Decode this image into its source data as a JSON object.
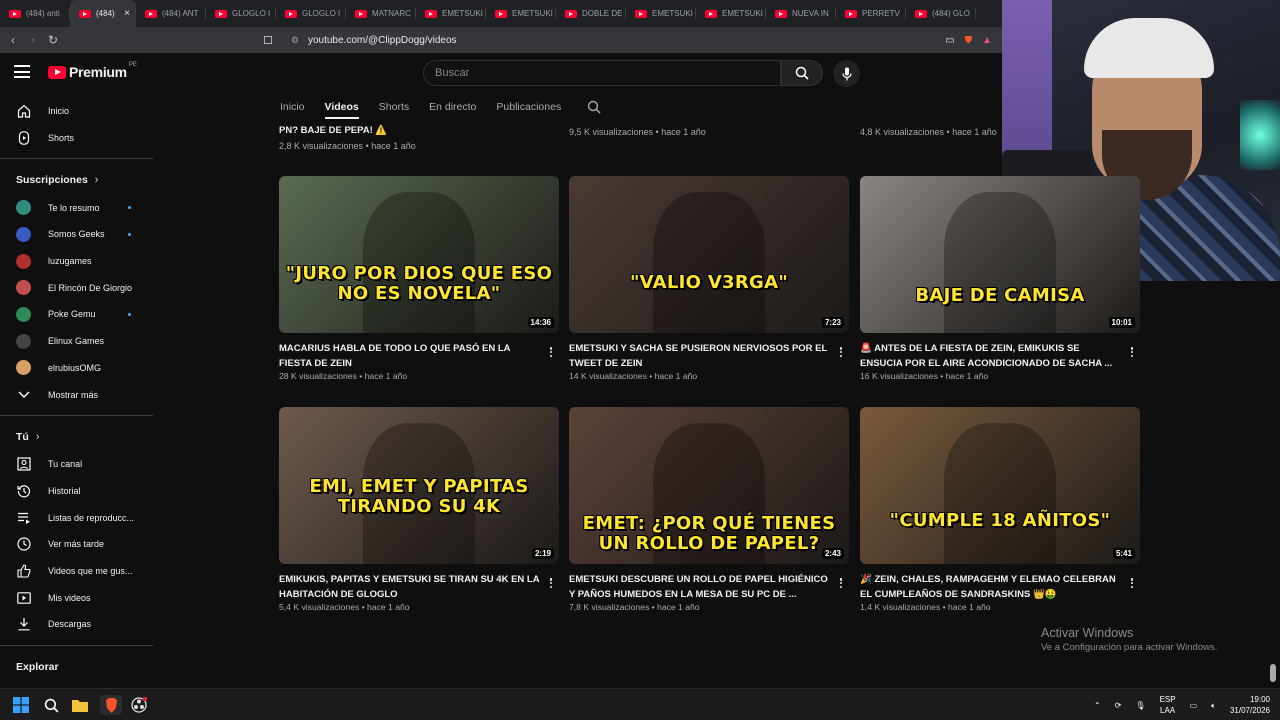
{
  "browser": {
    "tabs": [
      {
        "title": "(484) anti"
      },
      {
        "title": "(484)",
        "active": true
      },
      {
        "title": "(484) ANT"
      },
      {
        "title": "GLOGLO I"
      },
      {
        "title": "GLOGLO I"
      },
      {
        "title": "MATNARC"
      },
      {
        "title": "EMETSUKI"
      },
      {
        "title": "EMETSUKI"
      },
      {
        "title": "DOBLE DE"
      },
      {
        "title": "EMETSUKI"
      },
      {
        "title": "EMETSUKI"
      },
      {
        "title": "NUEVA IN"
      },
      {
        "title": "PERRETV"
      },
      {
        "title": "(484) GLO"
      }
    ],
    "close_glyph": "×",
    "url": "youtube.com/@ClippDogg/videos"
  },
  "youtube": {
    "logo_text": "Premium",
    "country_code": "PE",
    "search_placeholder": "Buscar",
    "sidebar": {
      "main": [
        {
          "label": "Inicio",
          "icon": "home-icon"
        },
        {
          "label": "Shorts",
          "icon": "shorts-icon"
        }
      ],
      "subs_header": "Suscripciones",
      "subs": [
        {
          "label": "Te lo resumo",
          "color": "#2f8f7f",
          "dot": true
        },
        {
          "label": "Somos Geeks",
          "color": "#3a5bbf",
          "dot": true
        },
        {
          "label": "luzugames",
          "color": "#b03030",
          "dot": false
        },
        {
          "label": "El Rincón De Giorgio",
          "color": "#c0504d",
          "dot": false
        },
        {
          "label": "Poke Gemu",
          "color": "#2e8b57",
          "dot": true
        },
        {
          "label": "Elinux Games",
          "color": "#444444",
          "dot": false
        },
        {
          "label": "elrubiusOMG",
          "color": "#d9a066",
          "dot": false
        },
        {
          "label": "Mostrar más",
          "icon": "chevron-down-icon"
        }
      ],
      "you_header": "Tú",
      "you": [
        {
          "label": "Tu canal",
          "icon": "user-icon"
        },
        {
          "label": "Historial",
          "icon": "history-icon"
        },
        {
          "label": "Listas de reproducc...",
          "icon": "playlist-icon"
        },
        {
          "label": "Ver más tarde",
          "icon": "clock-icon"
        },
        {
          "label": "Videos que me gus...",
          "icon": "like-icon"
        },
        {
          "label": "Mis videos",
          "icon": "video-icon"
        },
        {
          "label": "Descargas",
          "icon": "download-icon"
        }
      ],
      "explore_header": "Explorar"
    },
    "channel_tabs": [
      "Inicio",
      "Videos",
      "Shorts",
      "En directo",
      "Publicaciones"
    ],
    "active_tab": "Videos",
    "partial_row": [
      {
        "title": "PN? BAJE DE PEPA! ⚠️",
        "meta": "2,8 K visualizaciones • hace 1 año"
      },
      {
        "meta": "9,5 K visualizaciones • hace 1 año"
      },
      {
        "meta": "4,8 K visualizaciones • hace 1 año"
      }
    ],
    "videos": [
      {
        "thumb_text": "\"JURO POR DIOS QUE ESO NO ES NOVELA\"",
        "duration": "14:36",
        "title": "MACARIUS HABLA DE TODO LO QUE PASÓ EN LA FIESTA DE ZEIN",
        "meta": "28 K visualizaciones • hace 1 año",
        "bg": "#5a6b52"
      },
      {
        "thumb_text": "\"VALIO V3RGA\"",
        "duration": "7:23",
        "title": "EMETSUKI Y SACHA SE PUSIERON NERVIOSOS POR EL TWEET DE ZEIN",
        "meta": "14 K visualizaciones • hace 1 año",
        "bg": "#4a3a34"
      },
      {
        "thumb_text": "BAJE DE CAMISA",
        "duration": "10:01",
        "title": "🚨 ANTES DE LA FIESTA DE ZEIN, EMIKUKIS SE ENSUCIA POR EL AIRE ACONDICIONADO DE SACHA ...",
        "meta": "16 K visualizaciones • hace 1 año",
        "bg": "#8a8580"
      },
      {
        "thumb_text": "EMI, EMET Y PAPITAS TIRANDO SU 4K",
        "duration": "2:19",
        "title": "EMIKUKIS, PAPITAS Y EMETSUKI SE TIRAN SU 4K EN LA HABITACIÓN DE GLOGLO",
        "meta": "5,4 K visualizaciones • hace 1 año",
        "bg": "#6e5a4c"
      },
      {
        "thumb_text": "EMET: ¿POR QUÉ TIENES UN ROLLO DE PAPEL?",
        "duration": "2:43",
        "title": "EMETSUKI DESCUBRE UN ROLLO DE PAPEL HIGIÉNICO Y PAÑOS HUMEDOS EN LA MESA DE SU PC DE ...",
        "meta": "7,8 K visualizaciones • hace 1 año",
        "bg": "#5c4238"
      },
      {
        "thumb_text": "\"CUMPLE 18 AÑITOS\"",
        "duration": "5:41",
        "title": "🎉 ZEIN, CHALES, RAMPAGEHM Y ELEMAO CELEBRAN EL CUMPLEAÑOS DE SANDRASKINS 👑🤑",
        "meta": "1,4 K visualizaciones • hace 1 año",
        "bg": "#7a5a3c"
      }
    ]
  },
  "watermark": {
    "line1": "Activar Windows",
    "line2": "Ve a Configuración para activar Windows."
  },
  "taskbar": {
    "lang": "ESP",
    "layout": "LAA",
    "time": "19:00",
    "date": "31/07/2026"
  },
  "colors": {
    "brand_red": "#ff0033",
    "bg": "#0f0f0f",
    "thumb_caption": "#ffe52e"
  }
}
